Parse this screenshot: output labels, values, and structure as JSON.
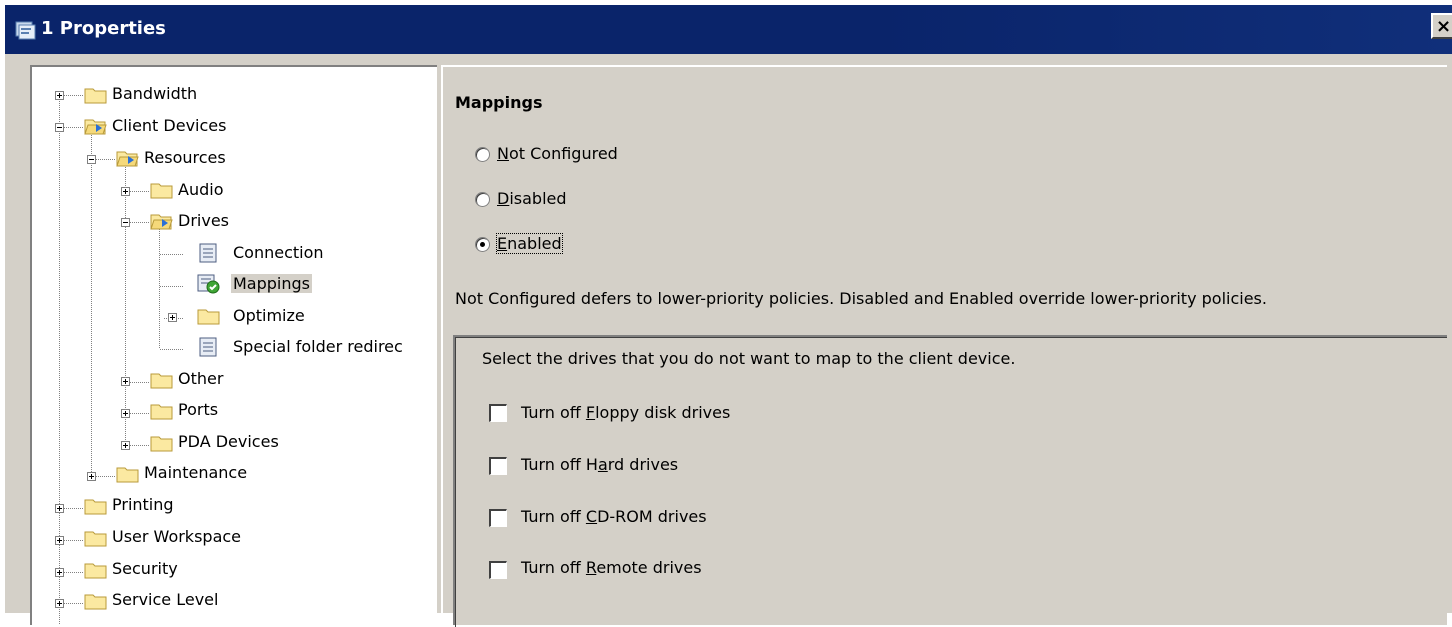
{
  "window": {
    "title": "1 Properties",
    "close_label": "×"
  },
  "tree": {
    "items": [
      {
        "label": "Bandwidth"
      },
      {
        "label": "Client Devices"
      },
      {
        "label": "Resources"
      },
      {
        "label": "Audio"
      },
      {
        "label": "Drives"
      },
      {
        "label": "Connection"
      },
      {
        "label": "Mappings"
      },
      {
        "label": "Optimize"
      },
      {
        "label": "Special folder redirec"
      },
      {
        "label": "Other"
      },
      {
        "label": "Ports"
      },
      {
        "label": "PDA Devices"
      },
      {
        "label": "Maintenance"
      },
      {
        "label": "Printing"
      },
      {
        "label": "User Workspace"
      },
      {
        "label": "Security"
      },
      {
        "label": "Service Level"
      }
    ]
  },
  "setting": {
    "heading": "Mappings",
    "options": [
      {
        "prefix": "",
        "mnemonic": "N",
        "rest": "ot Configured",
        "selected": false
      },
      {
        "prefix": "",
        "mnemonic": "D",
        "rest": "isabled",
        "selected": false
      },
      {
        "prefix": "",
        "mnemonic": "E",
        "rest": "nabled",
        "selected": true
      }
    ],
    "note": "Not Configured defers to lower-priority policies. Disabled and Enabled override lower-priority policies."
  },
  "drives": {
    "description": "Select the drives that you do not want to map to the client device.",
    "checkboxes": [
      {
        "prefix": "Turn off ",
        "mnemonic": "F",
        "rest": "loppy disk drives",
        "checked": false
      },
      {
        "prefix": "Turn off H",
        "mnemonic": "a",
        "rest": "rd drives",
        "checked": false
      },
      {
        "prefix": "Turn off ",
        "mnemonic": "C",
        "rest": "D-ROM drives",
        "checked": false
      },
      {
        "prefix": "Turn off ",
        "mnemonic": "R",
        "rest": "emote drives",
        "checked": false
      }
    ]
  }
}
